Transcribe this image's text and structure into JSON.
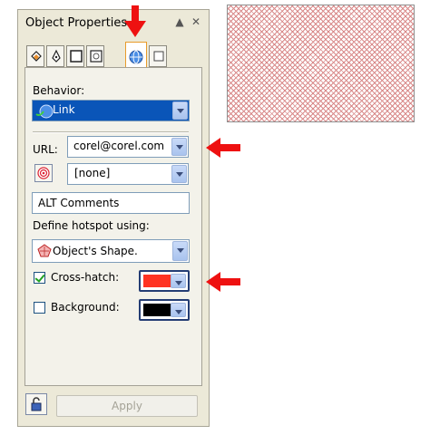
{
  "panel": {
    "title": "Object Properties",
    "collapse_glyph": "▲",
    "close_glyph": "✕",
    "tabs": [
      {
        "icon": "fill-bucket-icon"
      },
      {
        "icon": "pen-nib-icon"
      },
      {
        "icon": "outline-frame-icon"
      },
      {
        "icon": "general-frame-icon"
      },
      {
        "icon": "internet-globe-icon",
        "active": true
      },
      {
        "icon": "summary-blank-icon"
      }
    ]
  },
  "behavior": {
    "label": "Behavior:",
    "value": "Link",
    "icon": "link-globe-icon"
  },
  "url": {
    "label": "URL:",
    "value": "corel@corel.com"
  },
  "target": {
    "icon": "target-icon",
    "value": "[none]"
  },
  "alt": {
    "value": "ALT Comments"
  },
  "hotspot": {
    "label": "Define hotspot using:",
    "value": "Object's Shape.",
    "icon": "shape-icon"
  },
  "crosshatch": {
    "label": "Cross-hatch:",
    "checked": true,
    "color": "#ff3322"
  },
  "background": {
    "label": "Background:",
    "checked": false,
    "color": "#000000"
  },
  "footer": {
    "apply_label": "Apply",
    "lock_icon": "lock-icon"
  },
  "preview": {
    "pattern": "cross-hatch",
    "color": "#d98a8a"
  },
  "annotation": {
    "arrow_color": "#ee1111"
  }
}
